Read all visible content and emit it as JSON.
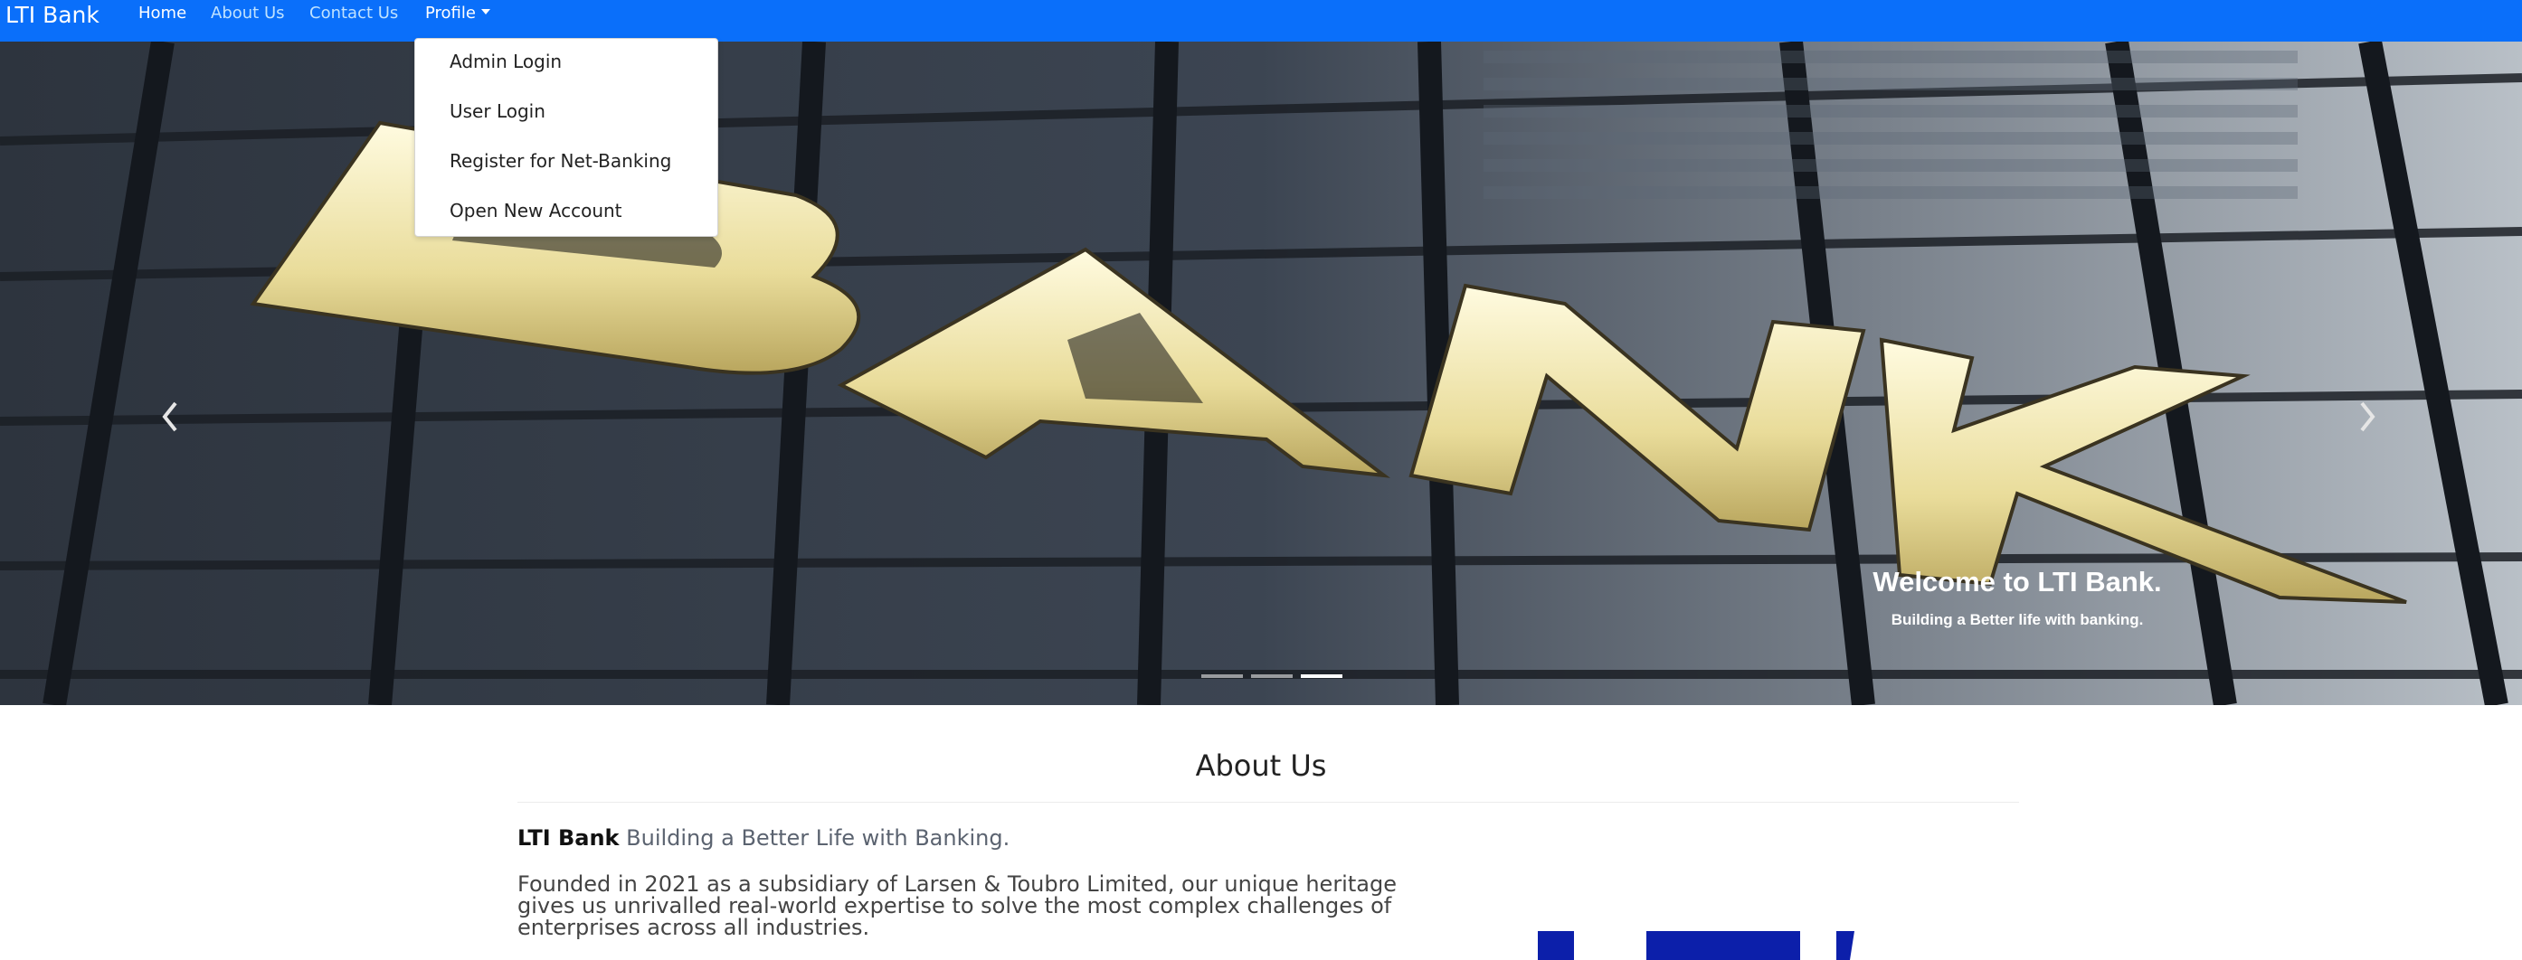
{
  "navbar": {
    "brand": "LTI Bank",
    "links": [
      "Home",
      "About Us",
      "Contact Us"
    ],
    "profile": "Profile"
  },
  "profile_menu": {
    "items": [
      "Admin Login",
      "User Login",
      "Register for Net-Banking",
      "Open New Account"
    ]
  },
  "hero": {
    "caption_title": "Welcome to LTI Bank.",
    "caption_sub": "Building a Better life with banking.",
    "sign_text": "BANK",
    "slides_count": 3,
    "active_slide": 3
  },
  "about": {
    "title": "About Us",
    "lead_bold": "LTI Bank",
    "lead_rest": " Building a Better Life with Banking.",
    "paragraph": "Founded in 2021 as a subsidiary of Larsen & Toubro Limited, our unique heritage gives us unrivalled real-world expertise to solve the most complex challenges of enterprises across all industries."
  },
  "colors": {
    "navbar": "#0a6ffa",
    "accent_blue": "#0c1faa"
  },
  "icons": [
    "chevron-left-icon",
    "chevron-right-icon",
    "caret-down-icon"
  ]
}
